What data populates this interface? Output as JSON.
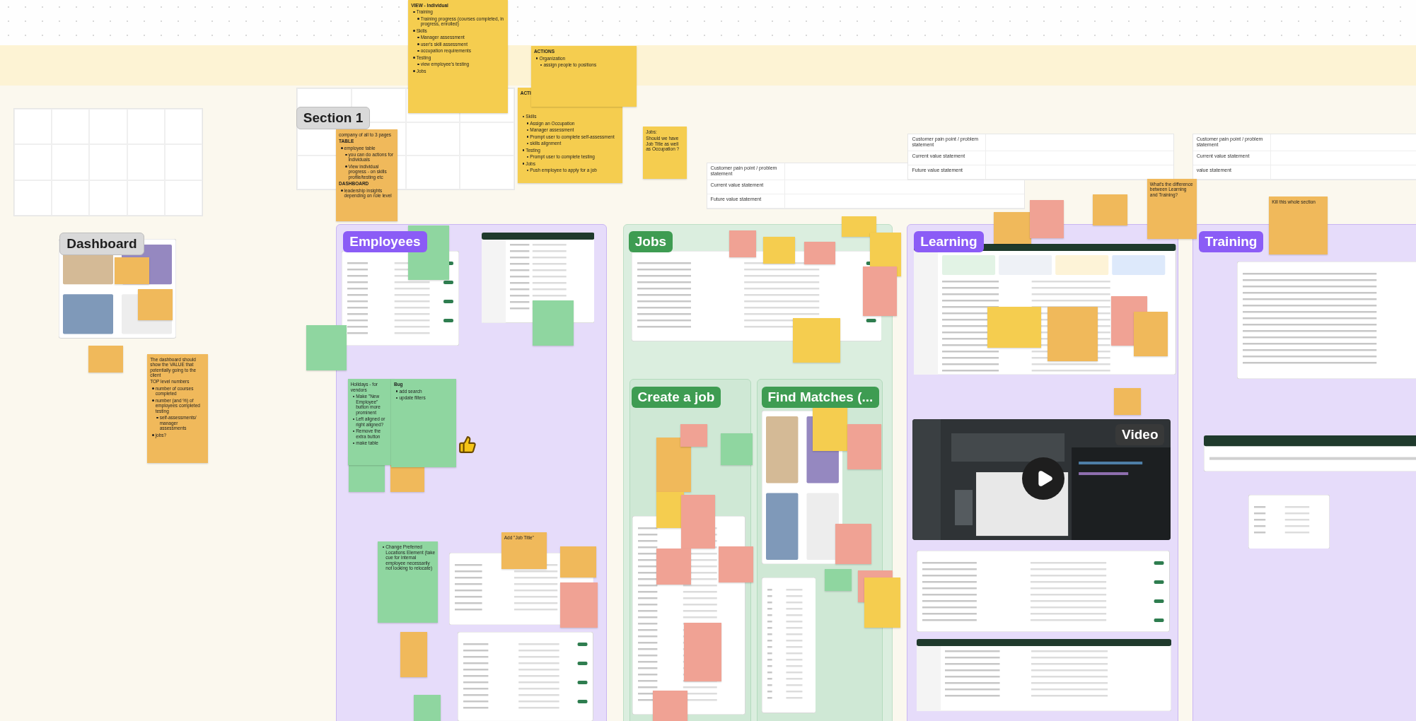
{
  "sections": [
    {
      "title": "Section 1",
      "kind": "gray"
    },
    {
      "title": "Dashboard",
      "kind": "gray"
    },
    {
      "title": "Employees",
      "kind": "purple"
    },
    {
      "title": "Jobs",
      "kind": "green"
    },
    {
      "title": "Learning",
      "kind": "purple"
    },
    {
      "title": "Training",
      "kind": "purple"
    },
    {
      "title": "Create a job",
      "kind": "green"
    },
    {
      "title": "Find Matches (...",
      "kind": "green"
    },
    {
      "title": "Video",
      "kind": "dark"
    }
  ],
  "value_tables": [
    {
      "rows": [
        "Customer pain point / problem statement",
        "Current value statement",
        "Future value statement"
      ]
    },
    {
      "rows": [
        "Customer pain point / problem statement",
        "Current value statement",
        "Future value statement"
      ]
    },
    {
      "rows": [
        "Customer pain point / problem statement",
        "Current value statement",
        "value statement"
      ]
    }
  ],
  "stickies": [
    {
      "color": "#f5cd4f",
      "lines": [
        {
          "kind": "heading",
          "text": "VIEW - Individual"
        },
        {
          "kind": "bullet",
          "text": "Training"
        },
        {
          "kind": "sub",
          "text": "Training progress (courses completed, in progress, enrolled)"
        },
        {
          "kind": "bullet",
          "text": "Skills"
        },
        {
          "kind": "sub",
          "text": "Manager assessment"
        },
        {
          "kind": "sub",
          "text": "user's skill assessment"
        },
        {
          "kind": "sub",
          "text": "occupation requirements"
        },
        {
          "kind": "bullet",
          "text": "Testing"
        },
        {
          "kind": "sub",
          "text": "view employee's testing"
        },
        {
          "kind": "bullet",
          "text": "Jobs"
        }
      ]
    },
    {
      "color": "#f5cd4f",
      "lines": [
        {
          "kind": "heading",
          "text": "ACTIONS"
        },
        {
          "kind": "bullet",
          "text": "Organization"
        },
        {
          "kind": "sub",
          "text": "assign people to positions"
        }
      ]
    },
    {
      "color": "#f5cd4f",
      "lines": [
        {
          "kind": "heading",
          "text": "ACTI"
        },
        {
          "kind": "bullet",
          "text": "Skills"
        },
        {
          "kind": "sub",
          "text": "Assign an Occupation"
        },
        {
          "kind": "sub",
          "text": "Manager assessment"
        },
        {
          "kind": "sub",
          "text": "Prompt user to complete self-assessment"
        },
        {
          "kind": "sub",
          "text": "skills alignment"
        },
        {
          "kind": "bullet",
          "text": "Testing"
        },
        {
          "kind": "sub",
          "text": "Prompt user to complete testing"
        },
        {
          "kind": "bullet",
          "text": "Jobs"
        },
        {
          "kind": "sub",
          "text": "Push employee to apply for a job"
        }
      ]
    },
    {
      "color": "#f0b95b",
      "lines": [
        {
          "kind": "text",
          "text": "company of all to 3 pages"
        },
        {
          "kind": "heading",
          "text": "TABLE"
        },
        {
          "kind": "bullet",
          "text": "employee table"
        },
        {
          "kind": "sub",
          "text": "you can do actions for individuals"
        },
        {
          "kind": "sub",
          "text": "View individual progress - on skills profile/testing etc"
        },
        {
          "kind": "heading",
          "text": "DASHBOARD"
        },
        {
          "kind": "bullet",
          "text": "leadership insights depending on role level"
        }
      ]
    },
    {
      "color": "#f5cd4f",
      "lines": [
        {
          "kind": "text",
          "text": "Jobs:"
        },
        {
          "kind": "text",
          "text": "Should we have Job Title as well as Occupation ?"
        }
      ]
    },
    {
      "color": "#f0b95b",
      "lines": [
        {
          "kind": "text",
          "text": "What's the difference between Learning and Training?"
        }
      ]
    },
    {
      "color": "#f0b95b",
      "lines": [
        {
          "kind": "text",
          "text": "Kill this whole section"
        }
      ]
    },
    {
      "color": "#f0b95b",
      "lines": [
        {
          "kind": "text",
          "text": "The dashboard should show the VALUE that potentially going to the client"
        },
        {
          "kind": "text",
          "text": "TOP level numbers"
        },
        {
          "kind": "bullet",
          "text": "number of courses completed"
        },
        {
          "kind": "bullet",
          "text": "number (and %) of employees completed testing"
        },
        {
          "kind": "sub",
          "text": "self-assessments/ manager assessments"
        },
        {
          "kind": "bullet",
          "text": "jobs?"
        }
      ]
    },
    {
      "color": "#8fd6a0",
      "lines": [
        {
          "kind": "text",
          "text": "Holidays - for vendors"
        },
        {
          "kind": "bullet",
          "text": "Make \"New Employee\" button more prominent"
        },
        {
          "kind": "bullet",
          "text": "Left aligned or right aligned?"
        },
        {
          "kind": "bullet",
          "text": "Remove the extra button"
        },
        {
          "kind": "bullet",
          "text": "make table"
        }
      ]
    },
    {
      "color": "#8fd6a0",
      "lines": [
        {
          "kind": "heading",
          "text": "Bug"
        },
        {
          "kind": "bullet",
          "text": "add search"
        },
        {
          "kind": "bullet",
          "text": "update filters"
        }
      ]
    },
    {
      "color": "#f0b95b",
      "lines": [
        {
          "kind": "text",
          "text": "Add \"Job Title\""
        }
      ]
    },
    {
      "color": "#8fd6a0",
      "lines": [
        {
          "kind": "bullet",
          "text": "Change Preferred Locations Element (take cue for internal employee necessarily not looking to relocate)"
        }
      ]
    }
  ],
  "blank_notes": [
    {
      "color": "#f0a294"
    },
    {
      "color": "#f5cd4f"
    },
    {
      "color": "#f0a294"
    },
    {
      "color": "#f5cd4f"
    },
    {
      "color": "#f5cd4f"
    },
    {
      "color": "#f0a294"
    },
    {
      "color": "#f5cd4f"
    },
    {
      "color": "#f0b95b"
    },
    {
      "color": "#f0a294"
    },
    {
      "color": "#f0b95b"
    },
    {
      "color": "#f0a294"
    },
    {
      "color": "#f0b95b"
    },
    {
      "color": "#f0b95b"
    },
    {
      "color": "#f5cd4f"
    },
    {
      "color": "#8fd6a0"
    },
    {
      "color": "#8fd6a0"
    },
    {
      "color": "#8fd6a0"
    },
    {
      "color": "#f0b95b"
    },
    {
      "color": "#f0b95b"
    },
    {
      "color": "#f0b95b"
    },
    {
      "color": "#f0b95b"
    },
    {
      "color": "#8fd6a0"
    },
    {
      "color": "#f0b95b"
    },
    {
      "color": "#8fd6a0"
    },
    {
      "color": "#f0b95b"
    },
    {
      "color": "#f0a294"
    },
    {
      "color": "#8fd6a0"
    },
    {
      "color": "#f5cd4f"
    },
    {
      "color": "#f0a294"
    },
    {
      "color": "#f0a294"
    },
    {
      "color": "#f0a294"
    },
    {
      "color": "#f0b95b"
    },
    {
      "color": "#f0a294"
    },
    {
      "color": "#f5cd4f"
    },
    {
      "color": "#f0a294"
    },
    {
      "color": "#f0a294"
    },
    {
      "color": "#f0a294"
    },
    {
      "color": "#8fd6a0"
    },
    {
      "color": "#f5cd4f"
    },
    {
      "color": "#f0a294"
    },
    {
      "color": "#f0a294"
    },
    {
      "color": "#f0b95b"
    }
  ]
}
